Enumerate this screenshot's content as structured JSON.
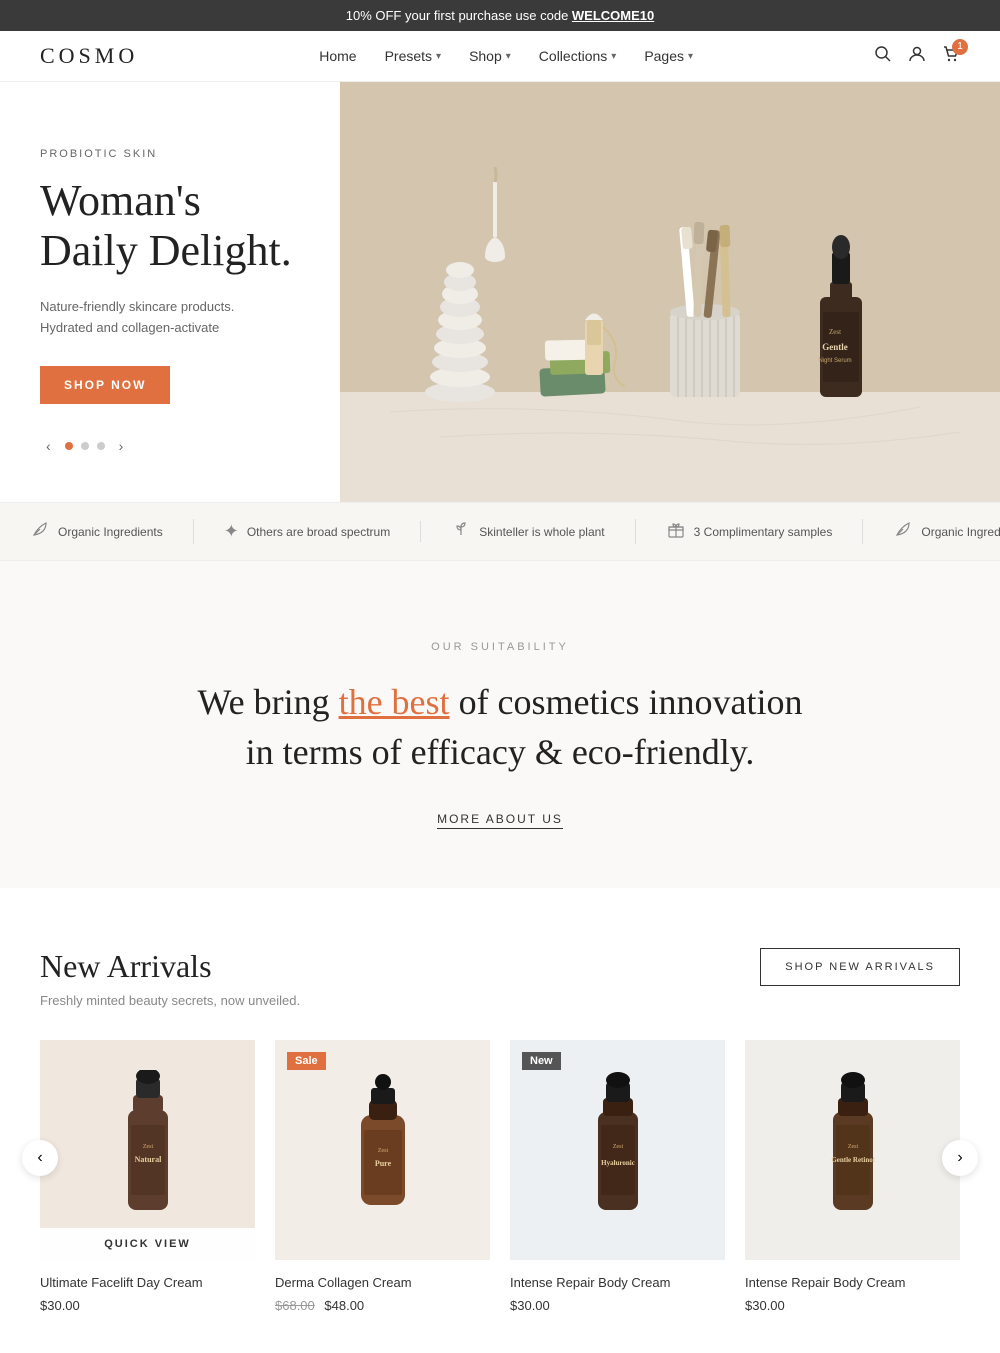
{
  "announcement": {
    "text": "10% OFF your first purchase use code ",
    "code": "WELCOME10"
  },
  "header": {
    "logo": "COSMO",
    "nav": [
      {
        "label": "Home",
        "hasDropdown": false
      },
      {
        "label": "Presets",
        "hasDropdown": true
      },
      {
        "label": "Shop",
        "hasDropdown": true
      },
      {
        "label": "Collections",
        "hasDropdown": true
      },
      {
        "label": "Pages",
        "hasDropdown": true
      }
    ],
    "cartCount": "1"
  },
  "hero": {
    "eyebrow": "PROBIOTIC SKIN",
    "title": "Woman's\nDaily Delight.",
    "description": "Nature-friendly skincare products.\nHydrated and collagen-activate",
    "shopNowLabel": "SHOP NOW",
    "dots": [
      true,
      false,
      false
    ]
  },
  "features": [
    {
      "icon": "🌿",
      "text": "Organic Ingredients"
    },
    {
      "icon": "✦",
      "text": "Others are broad spectrum"
    },
    {
      "icon": "🌱",
      "text": "Skinteller is whole plant"
    },
    {
      "icon": "🎁",
      "text": "3 Complimentary samples"
    },
    {
      "icon": "🌿",
      "text": "Organic Ingredients"
    }
  ],
  "suitability": {
    "label": "OUR SUITABILITY",
    "titleBefore": "We bring ",
    "titleHighlight": "the best",
    "titleAfter": " of cosmetics innovation\nin terms of efficacy & eco-friendly.",
    "moreAboutLabel": "MORE ABOUT US"
  },
  "newArrivals": {
    "title": "New Arrivals",
    "subtitle": "Freshly minted beauty secrets, now unveiled.",
    "shopBtnLabel": "SHOP NEW ARRIVALS",
    "products": [
      {
        "name": "Ultimate Facelift Day Cream",
        "price": "$30.00",
        "originalPrice": null,
        "badge": null,
        "hasQuickView": true,
        "bgColor": "#f0e8de"
      },
      {
        "name": "Derma Collagen Cream",
        "price": "$48.00",
        "originalPrice": "$68.00",
        "badge": "Sale",
        "badgeType": "sale",
        "hasQuickView": false,
        "bgColor": "#f2ede6"
      },
      {
        "name": "Intense Repair Body Cream",
        "price": "$30.00",
        "originalPrice": null,
        "badge": "New",
        "badgeType": "new",
        "hasQuickView": false,
        "bgColor": "#edf0f2"
      },
      {
        "name": "Intense Repair Body Cream",
        "price": "$30.00",
        "originalPrice": null,
        "badge": null,
        "hasQuickView": false,
        "bgColor": "#f0eeea"
      }
    ]
  }
}
